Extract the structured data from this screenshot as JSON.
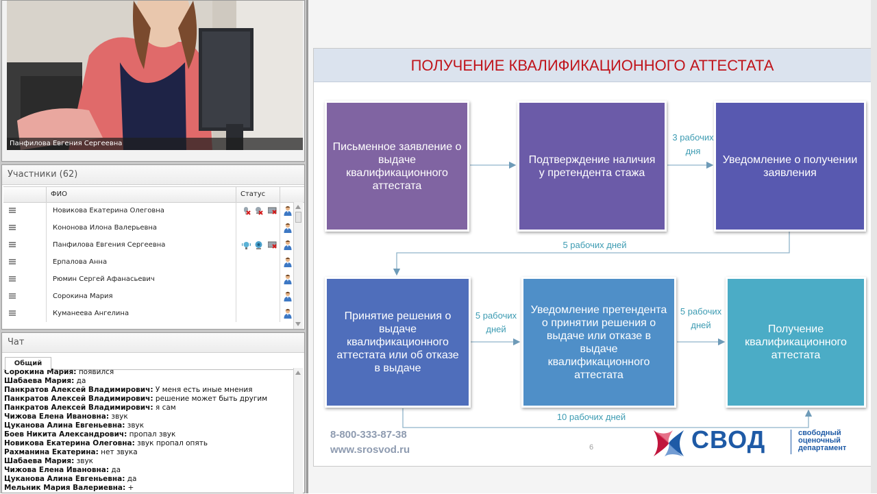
{
  "video": {
    "caption": "Панфилова Евгения Сергеевна"
  },
  "participants": {
    "title": "Участники (62)",
    "columns": [
      "ФИО",
      "Статус"
    ],
    "rows": [
      {
        "name": "Новикова Екатерина Олеговна",
        "status_icons": [
          "mic-muted-icon",
          "camera-muted-icon",
          "screen-muted-icon"
        ]
      },
      {
        "name": "Кононова Илона Валерьевна",
        "status_icons": []
      },
      {
        "name": "Панфилова Евгения Сергеевна",
        "status_icons": [
          "mic-active-icon",
          "camera-active-icon",
          "screen-muted-icon"
        ]
      },
      {
        "name": "Ерпалова Анна",
        "status_icons": []
      },
      {
        "name": "Рюмин Сергей Афанасьевич",
        "status_icons": []
      },
      {
        "name": "Сорокина Мария",
        "status_icons": []
      },
      {
        "name": "Куманеева Ангелина",
        "status_icons": []
      }
    ]
  },
  "chat": {
    "title": "Чат",
    "tab": "Общий",
    "messages": [
      {
        "author": "Сорокина Мария:",
        "text": " появился"
      },
      {
        "author": "Шабаева Мария:",
        "text": " да"
      },
      {
        "author": "Панкратов Алексей Владимирович:",
        "text": " У меня есть иные мнения"
      },
      {
        "author": "Панкратов Алексей Владимирович:",
        "text": " решение может быть другим"
      },
      {
        "author": "Панкратов Алексей Владимирович:",
        "text": " я сам"
      },
      {
        "author": "Чижова Елена Ивановна:",
        "text": " звук"
      },
      {
        "author": "Цуканова Алина Евгеньевна:",
        "text": " звук"
      },
      {
        "author": "Боев Никита  Александрович:",
        "text": " пропал звук"
      },
      {
        "author": "Новикова Екатерина Олеговна:",
        "text": " звук пропал опять"
      },
      {
        "author": "Рахманина Екатерина:",
        "text": " нет звука"
      },
      {
        "author": "Шабаева Мария:",
        "text": " звук"
      },
      {
        "author": "Чижова Елена Ивановна:",
        "text": " да"
      },
      {
        "author": "Цуканова Алина Евгеньевна:",
        "text": " да"
      },
      {
        "author": "Мельник Мария Валериевна:",
        "text": " +"
      }
    ]
  },
  "slide": {
    "title": "ПОЛУЧЕНИЕ КВАЛИФИКАЦИОННОГО АТТЕСТАТА",
    "boxes": {
      "b1": "Письменное заявление о выдаче квалификационного аттестата",
      "b2": "Подтверждение наличия у претендента стажа",
      "b3": "Уведомление о получении заявления",
      "b4": "Принятие решения о выдаче квалификационного аттестата или об отказе в выдаче",
      "b5": "Уведомление претендента о принятии решения о выдаче или отказе в выдаче квалификационного аттестата",
      "b6": "Получение квалификационного аттестата"
    },
    "labels": {
      "l_b2_b3": "3 рабочих дня",
      "l_b3_b4": "5  рабочих дней",
      "l_b4_b5": "5 рабочих дней",
      "l_b5_b6": "5 рабочих дней",
      "l_b4_b6": "10  рабочих дней"
    },
    "phone": "8-800-333-87-38",
    "website": "www.srosvod.ru",
    "page_number": "6",
    "logo": {
      "word": "СВОД",
      "tagline_1": "свободный",
      "tagline_2": "оценочный",
      "tagline_3": "департамент"
    },
    "colors": {
      "title": "#c0141b",
      "box_purple": "#8064a2",
      "box_indigo": "#5859b0",
      "box_blue": "#4f6ebb",
      "box_steel": "#4f8fc8",
      "box_teal": "#4bacc6",
      "label": "#3c9bb2"
    }
  }
}
